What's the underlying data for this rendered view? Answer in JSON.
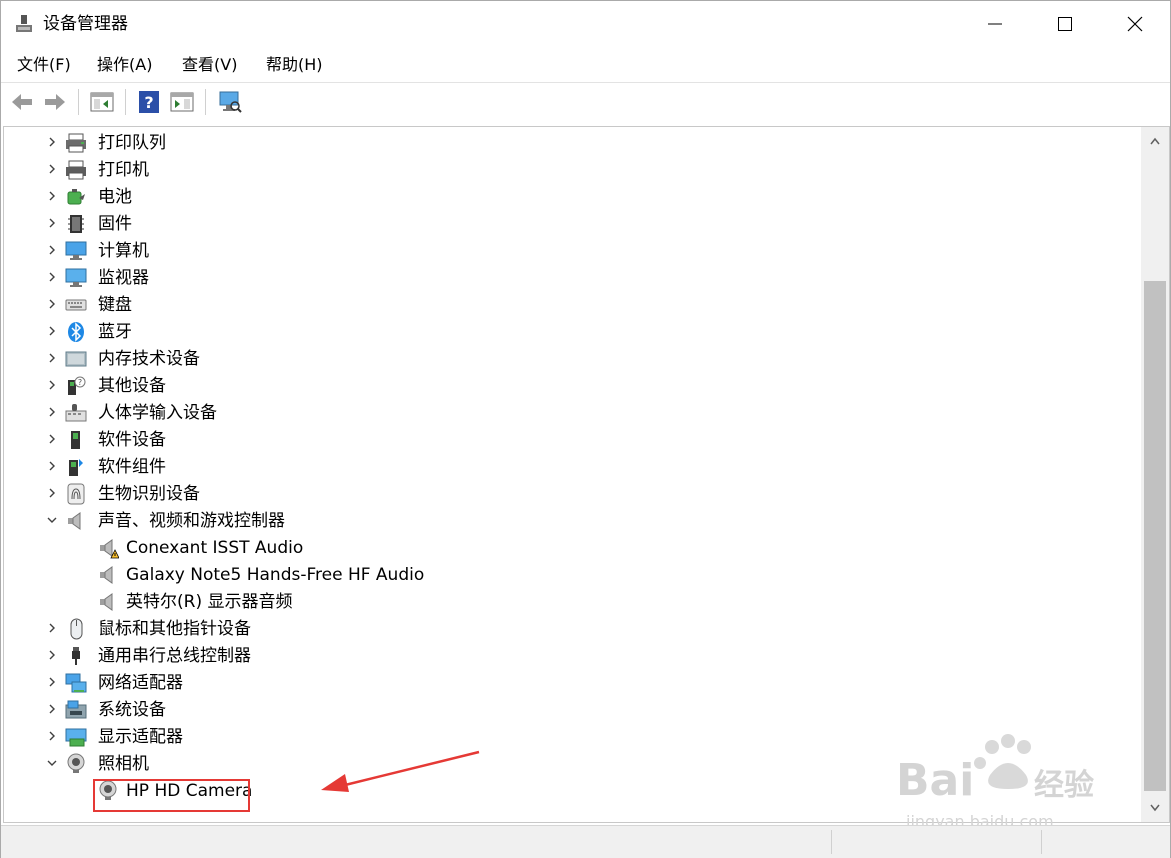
{
  "window": {
    "title": "设备管理器"
  },
  "menu": [
    "文件(F)",
    "操作(A)",
    "查看(V)",
    "帮助(H)"
  ],
  "toolbar": [
    {
      "icon": "back-arrow-icon"
    },
    {
      "icon": "forward-arrow-icon"
    },
    {
      "icon": "show-hide-console-tree-icon"
    },
    {
      "icon": "help-icon"
    },
    {
      "icon": "properties-icon"
    },
    {
      "icon": "scan-hardware-icon"
    }
  ],
  "tree": [
    {
      "label": "打印队列",
      "icon": "print-queue-icon",
      "expander": "collapsed",
      "level": 0
    },
    {
      "label": "打印机",
      "icon": "printer-icon",
      "expander": "collapsed",
      "level": 0
    },
    {
      "label": "电池",
      "icon": "battery-icon",
      "expander": "collapsed",
      "level": 0
    },
    {
      "label": "固件",
      "icon": "firmware-icon",
      "expander": "collapsed",
      "level": 0
    },
    {
      "label": "计算机",
      "icon": "computer-icon",
      "expander": "collapsed",
      "level": 0
    },
    {
      "label": "监视器",
      "icon": "monitor-icon",
      "expander": "collapsed",
      "level": 0
    },
    {
      "label": "键盘",
      "icon": "keyboard-icon",
      "expander": "collapsed",
      "level": 0
    },
    {
      "label": "蓝牙",
      "icon": "bluetooth-icon",
      "expander": "collapsed",
      "level": 0
    },
    {
      "label": "内存技术设备",
      "icon": "memory-device-icon",
      "expander": "collapsed",
      "level": 0
    },
    {
      "label": "其他设备",
      "icon": "other-device-icon",
      "expander": "collapsed",
      "level": 0
    },
    {
      "label": "人体学输入设备",
      "icon": "hid-icon",
      "expander": "collapsed",
      "level": 0
    },
    {
      "label": "软件设备",
      "icon": "software-device-icon",
      "expander": "collapsed",
      "level": 0
    },
    {
      "label": "软件组件",
      "icon": "software-component-icon",
      "expander": "collapsed",
      "level": 0
    },
    {
      "label": "生物识别设备",
      "icon": "fingerprint-icon",
      "expander": "collapsed",
      "level": 0
    },
    {
      "label": "声音、视频和游戏控制器",
      "icon": "speaker-icon",
      "expander": "expanded",
      "level": 0
    },
    {
      "label": "Conexant ISST Audio",
      "icon": "speaker-warning-icon",
      "expander": "none",
      "level": 1
    },
    {
      "label": "Galaxy Note5 Hands-Free HF Audio",
      "icon": "speaker-icon",
      "expander": "none",
      "level": 1
    },
    {
      "label": "英特尔(R) 显示器音频",
      "icon": "speaker-icon",
      "expander": "none",
      "level": 1
    },
    {
      "label": "鼠标和其他指针设备",
      "icon": "mouse-icon",
      "expander": "collapsed",
      "level": 0
    },
    {
      "label": "通用串行总线控制器",
      "icon": "usb-icon",
      "expander": "collapsed",
      "level": 0
    },
    {
      "label": "网络适配器",
      "icon": "network-adapter-icon",
      "expander": "collapsed",
      "level": 0
    },
    {
      "label": "系统设备",
      "icon": "system-device-icon",
      "expander": "collapsed",
      "level": 0
    },
    {
      "label": "显示适配器",
      "icon": "display-adapter-icon",
      "expander": "collapsed",
      "level": 0
    },
    {
      "label": "照相机",
      "icon": "camera-icon",
      "expander": "expanded",
      "level": 0
    },
    {
      "label": "HP HD Camera",
      "icon": "webcam-icon",
      "expander": "none",
      "level": 1,
      "highlighted": true
    }
  ],
  "watermark": {
    "brand": "Bai",
    "brand2": "经验",
    "url": "jingyan.baidu.com"
  },
  "colors": {
    "highlight": "#e53935",
    "arrow": "#e53935",
    "accent": "#1e88e5"
  }
}
